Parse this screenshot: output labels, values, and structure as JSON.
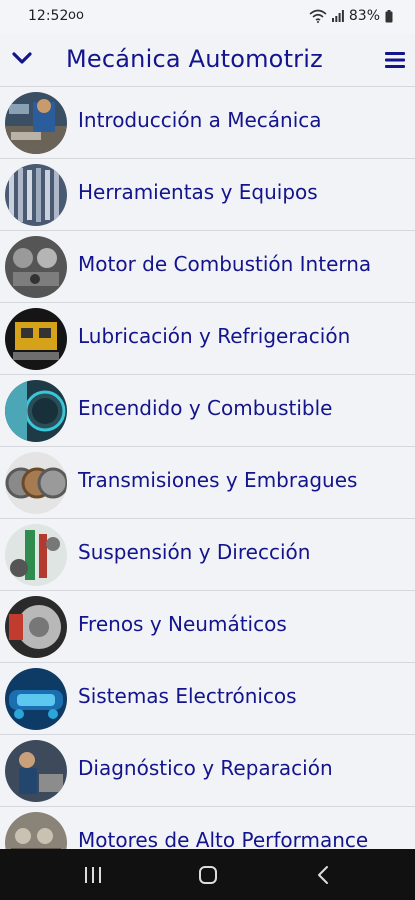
{
  "status_bar": {
    "time": "12:52",
    "voicemail_glyph": "oo",
    "battery": "83%"
  },
  "app_bar": {
    "title": "Mecánica Automotriz",
    "collapse_icon": "chevron-down-icon",
    "menu_icon": "hamburger-menu-icon"
  },
  "items": [
    {
      "label": "Introducción a Mecánica"
    },
    {
      "label": "Herramientas y Equipos"
    },
    {
      "label": "Motor de Combustión Interna"
    },
    {
      "label": "Lubricación y Refrigeración"
    },
    {
      "label": "Encendido y Combustible"
    },
    {
      "label": "Transmisiones y Embragues"
    },
    {
      "label": "Suspensión y Dirección"
    },
    {
      "label": "Frenos y Neumáticos"
    },
    {
      "label": "Sistemas Electrónicos"
    },
    {
      "label": "Diagnóstico y Reparación"
    },
    {
      "label": "Motores de Alto Performance"
    }
  ],
  "colors": {
    "accent": "#14148c",
    "background": "#f2f3f7",
    "divider": "#d6d8de",
    "nav_bar": "#111111"
  }
}
